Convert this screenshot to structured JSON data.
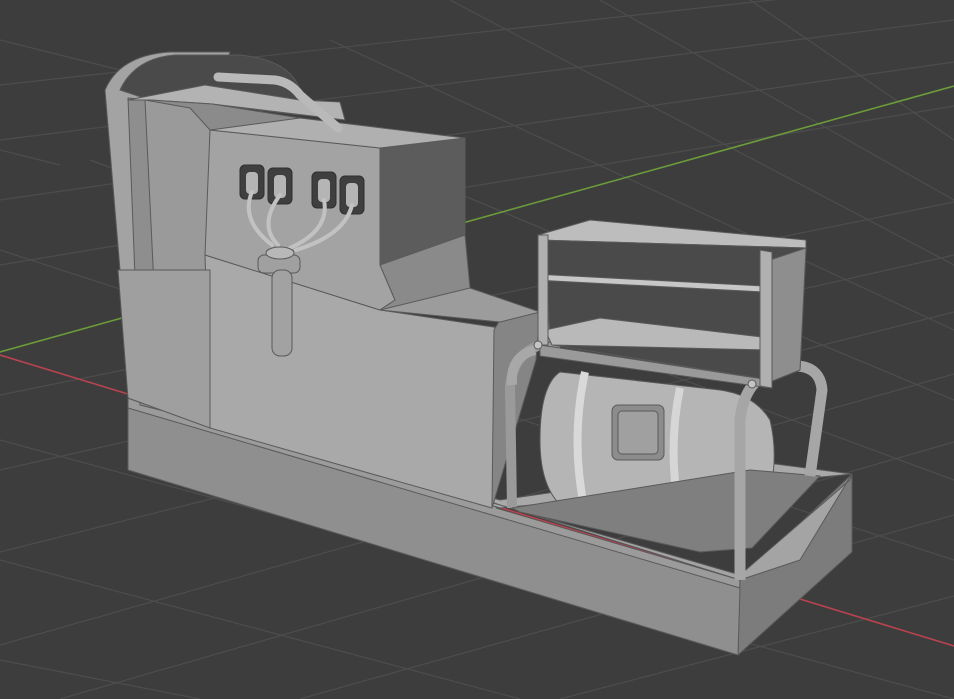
{
  "viewport": {
    "background": "#3d3d3d",
    "grid_color": "#4d4d4d",
    "axis_x_color": "#b8434e",
    "axis_y_color": "#6c9b3a",
    "shading": "solid",
    "object": "generator-model"
  }
}
